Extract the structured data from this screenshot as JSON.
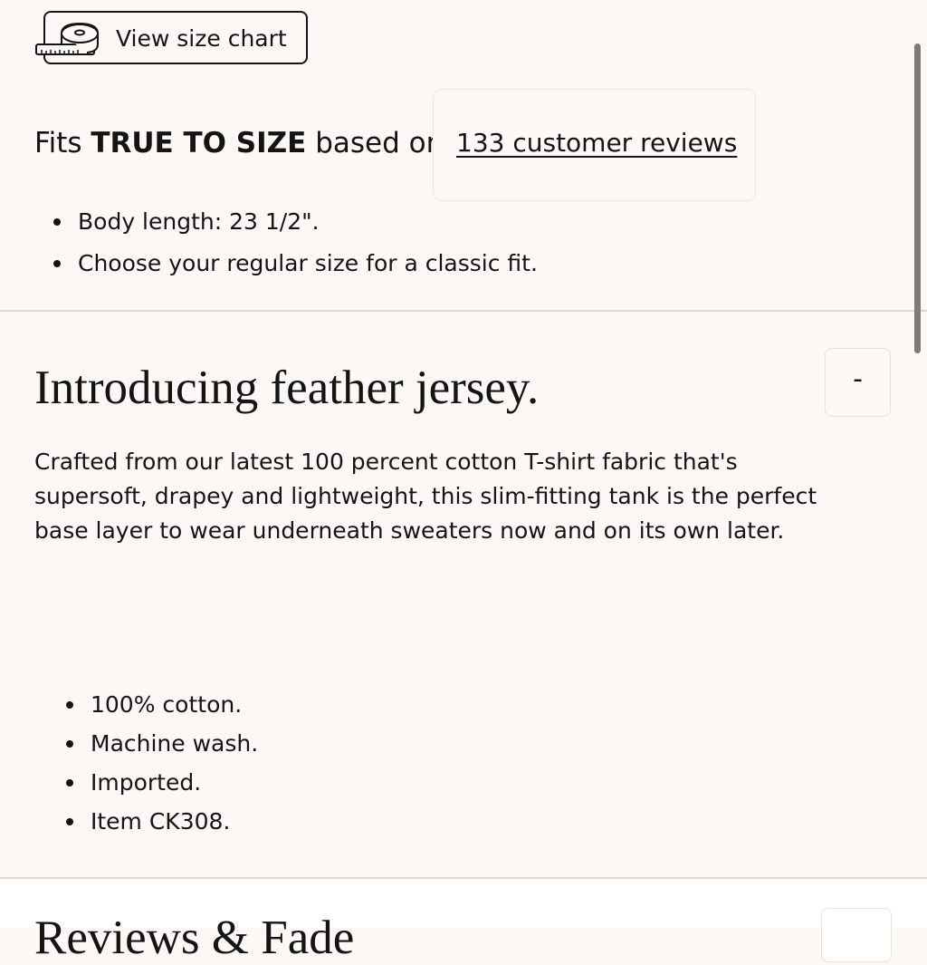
{
  "size_chart": {
    "label": "View size chart",
    "icon": "measuring-tape-icon"
  },
  "fit": {
    "prefix": "Fits",
    "emphasis": "TRUE TO SIZE",
    "suffix": "based on",
    "reviews_link": "133 customer reviews",
    "notes": [
      "Body length: 23 1/2\".",
      "Choose your regular size for a classic fit."
    ]
  },
  "product_details": {
    "title": "Introducing feather jersey.",
    "toggle_label": "-",
    "description": "Crafted from our latest 100 percent cotton T-shirt fabric that's supersoft, drapey and lightweight, this slim-fitting tank is the perfect base layer to wear underneath sweaters now and on its own later.",
    "specs": [
      "100% cotton.",
      "Machine wash.",
      "Imported.",
      "Item CK308."
    ]
  },
  "next_section": {
    "title": "Reviews & Fade"
  },
  "colors": {
    "page_background": "#fcf8f5",
    "text": "#141414",
    "divider": "#dcd8d5"
  }
}
